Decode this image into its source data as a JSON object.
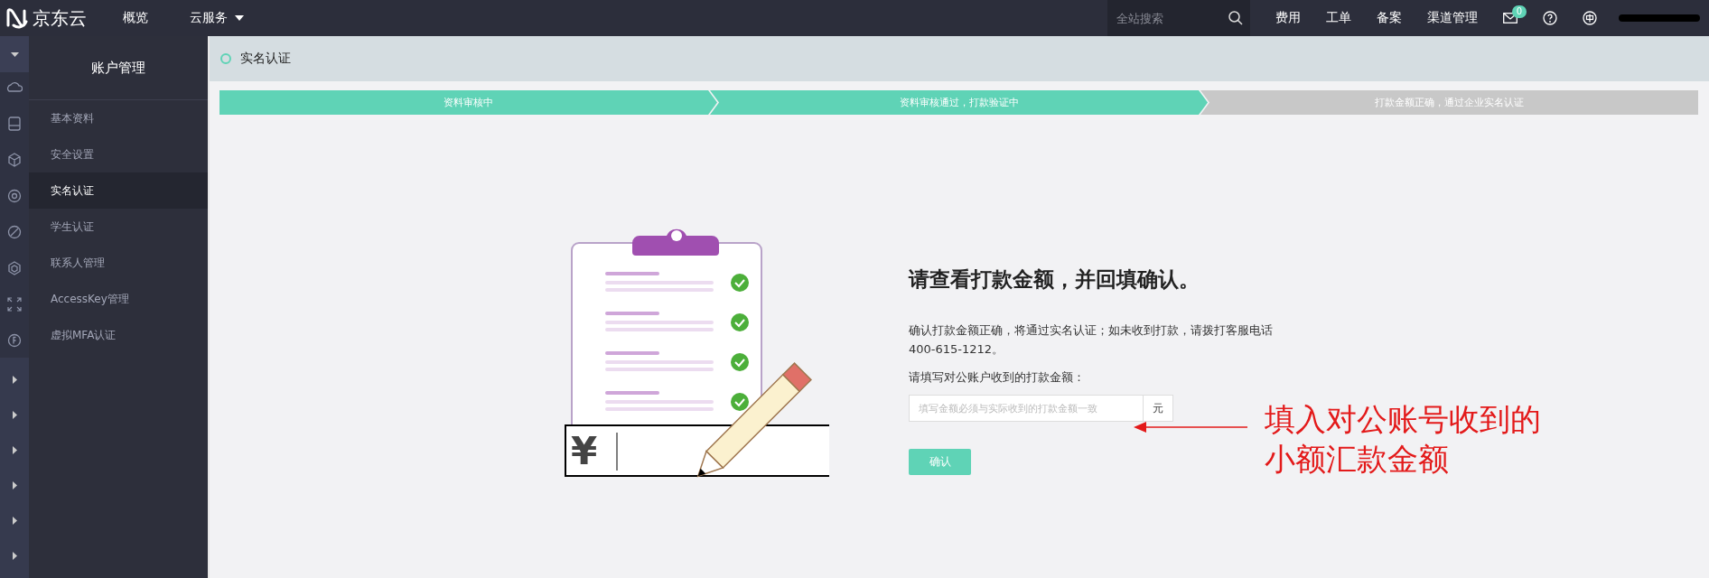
{
  "top_bar": {
    "logo": "京东云",
    "nav": [
      {
        "label": "概览",
        "dropdown": false
      },
      {
        "label": "云服务",
        "dropdown": true
      }
    ],
    "search": {
      "placeholder": "全站搜索"
    },
    "links": [
      "费用",
      "工单",
      "备案",
      "渠道管理"
    ],
    "mail_badge": "0"
  },
  "sidebar": {
    "title": "账户管理",
    "items": [
      {
        "label": "基本资料",
        "selected": false
      },
      {
        "label": "安全设置",
        "selected": false
      },
      {
        "label": "实名认证",
        "selected": true
      },
      {
        "label": "学生认证",
        "selected": false
      },
      {
        "label": "联系人管理",
        "selected": false
      },
      {
        "label": "AccessKey管理",
        "selected": false
      },
      {
        "label": "虚拟MFA认证",
        "selected": false
      }
    ]
  },
  "page_title": "实名认证",
  "steps": [
    {
      "label": "资料审核中",
      "done": true
    },
    {
      "label": "资料审核通过，打款验证中",
      "done": true
    },
    {
      "label": "打款金额正确，通过企业实名认证",
      "done": false
    }
  ],
  "illustration": {
    "currency_sign": "¥"
  },
  "form": {
    "heading": "请查看打款金额，并回填确认。",
    "description": [
      "确认打款金额正确，将通过实名认证；如未收到打款，请拨打客服电话",
      "400-615-1212。"
    ],
    "label": "请填写对公账户收到的打款金额：",
    "placeholder": "填写金额必须与实际收到的打款金额一致",
    "unit": "元",
    "button": "确认"
  },
  "annotation": {
    "lines": [
      "填入对公账号收到的",
      "小额汇款金额"
    ]
  }
}
